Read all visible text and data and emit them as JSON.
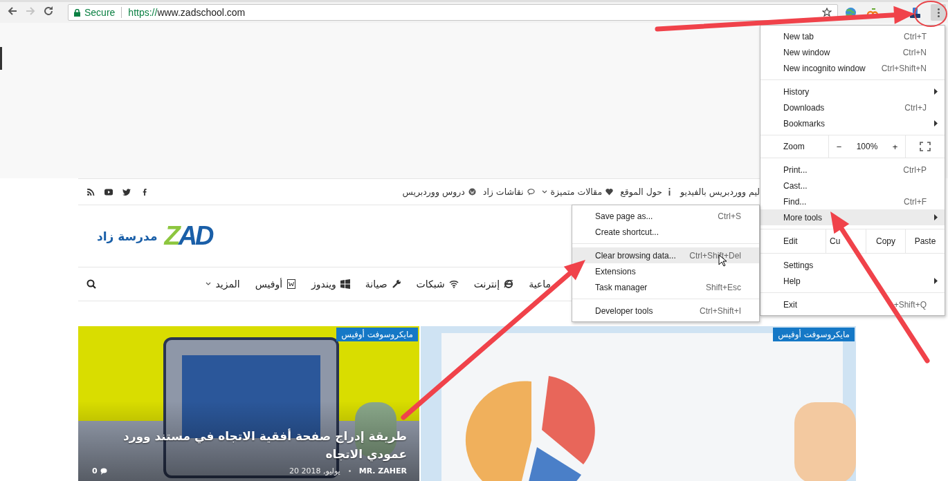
{
  "toolbar": {
    "nav_buttons": [
      {
        "kind": "back",
        "disabled": false
      },
      {
        "kind": "forward",
        "disabled": true
      },
      {
        "kind": "reload",
        "disabled": false
      }
    ],
    "omnibox": {
      "security": "Secure",
      "url_scheme": "https://",
      "url_host": "www.zadschool.com"
    },
    "menu_button": {
      "open": true
    }
  },
  "site": {
    "top_links": [
      {
        "label": "ليم ووردبريس بالفيديو",
        "dropdown": false
      },
      {
        "label": "حول الموقع",
        "dropdown": false
      },
      {
        "label": "مقالات متميزة",
        "dropdown": true
      },
      {
        "label": "نقاشات زاد",
        "dropdown": false
      },
      {
        "label": "دروس ووردبريس",
        "dropdown": false
      }
    ],
    "logo": {
      "mark": "ZAD",
      "name": "مدرسة زاد"
    },
    "nav": [
      {
        "label": "ماعية",
        "dropdown": false
      },
      {
        "label": "إنترنت",
        "dropdown": false
      },
      {
        "label": "شبكات",
        "dropdown": false
      },
      {
        "label": "صيانة",
        "dropdown": false
      },
      {
        "label": "ويندوز",
        "dropdown": false
      },
      {
        "label": "أوفيس",
        "dropdown": false
      },
      {
        "label": "المزيد",
        "dropdown": true
      }
    ],
    "cards": [
      {
        "category": "مايكروسوفت أوفيس"
      },
      {
        "category": "مايكروسوفت أوفيس",
        "title": "طريقة إدراج صفحة أفقية الاتجاه في مستند وورد عمودي الاتجاه",
        "author": "MR. ZAHER",
        "date": "20 يوليو, 2018",
        "comments": "0"
      }
    ]
  },
  "menu": {
    "items": [
      {
        "kind": "item",
        "label": "New tab",
        "shortcut": "Ctrl+T",
        "submenu": false,
        "highlighted": false
      },
      {
        "kind": "item",
        "label": "New window",
        "shortcut": "Ctrl+N",
        "submenu": false,
        "highlighted": false
      },
      {
        "kind": "item",
        "label": "New incognito window",
        "shortcut": "Ctrl+Shift+N",
        "submenu": false,
        "highlighted": false
      },
      {
        "kind": "separator"
      },
      {
        "kind": "item",
        "label": "History",
        "submenu": true,
        "highlighted": false
      },
      {
        "kind": "item",
        "label": "Downloads",
        "shortcut": "Ctrl+J",
        "submenu": false,
        "highlighted": false
      },
      {
        "kind": "item",
        "label": "Bookmarks",
        "submenu": true,
        "highlighted": false
      },
      {
        "kind": "separator"
      },
      {
        "kind": "zoom",
        "label": "Zoom",
        "minus": "−",
        "value": "100%",
        "plus": "+"
      },
      {
        "kind": "separator"
      },
      {
        "kind": "item",
        "label": "Print...",
        "shortcut": "Ctrl+P",
        "submenu": false,
        "highlighted": false
      },
      {
        "kind": "item",
        "label": "Cast...",
        "submenu": false,
        "highlighted": false
      },
      {
        "kind": "item",
        "label": "Find...",
        "shortcut": "Ctrl+F",
        "submenu": false,
        "highlighted": false
      },
      {
        "kind": "item",
        "label": "More tools",
        "submenu": true,
        "highlighted": true
      },
      {
        "kind": "separator"
      },
      {
        "kind": "edit",
        "label": "Edit",
        "cut": "Cu",
        "copy": "Copy",
        "paste": "Paste"
      },
      {
        "kind": "separator"
      },
      {
        "kind": "item",
        "label": "Settings",
        "submenu": false,
        "highlighted": false
      },
      {
        "kind": "item",
        "label": "Help",
        "submenu": true,
        "highlighted": false
      },
      {
        "kind": "separator"
      },
      {
        "kind": "item",
        "label": "Exit",
        "shortcut": "+Shift+Q",
        "submenu": false,
        "highlighted": false
      }
    ]
  },
  "submenu": {
    "items": [
      {
        "kind": "item",
        "label": "Save page as...",
        "shortcut": "Ctrl+S",
        "highlighted": false
      },
      {
        "kind": "item",
        "label": "Create shortcut...",
        "highlighted": false
      },
      {
        "kind": "separator"
      },
      {
        "kind": "item",
        "label": "Clear browsing data...",
        "shortcut": "Ctrl+Shift+Del",
        "highlighted": true
      },
      {
        "kind": "item",
        "label": "Extensions",
        "highlighted": false
      },
      {
        "kind": "item",
        "label": "Task manager",
        "shortcut": "Shift+Esc",
        "highlighted": false
      },
      {
        "kind": "separator"
      },
      {
        "kind": "item",
        "label": "Developer tools",
        "shortcut": "Ctrl+Shift+I",
        "highlighted": false
      }
    ]
  }
}
